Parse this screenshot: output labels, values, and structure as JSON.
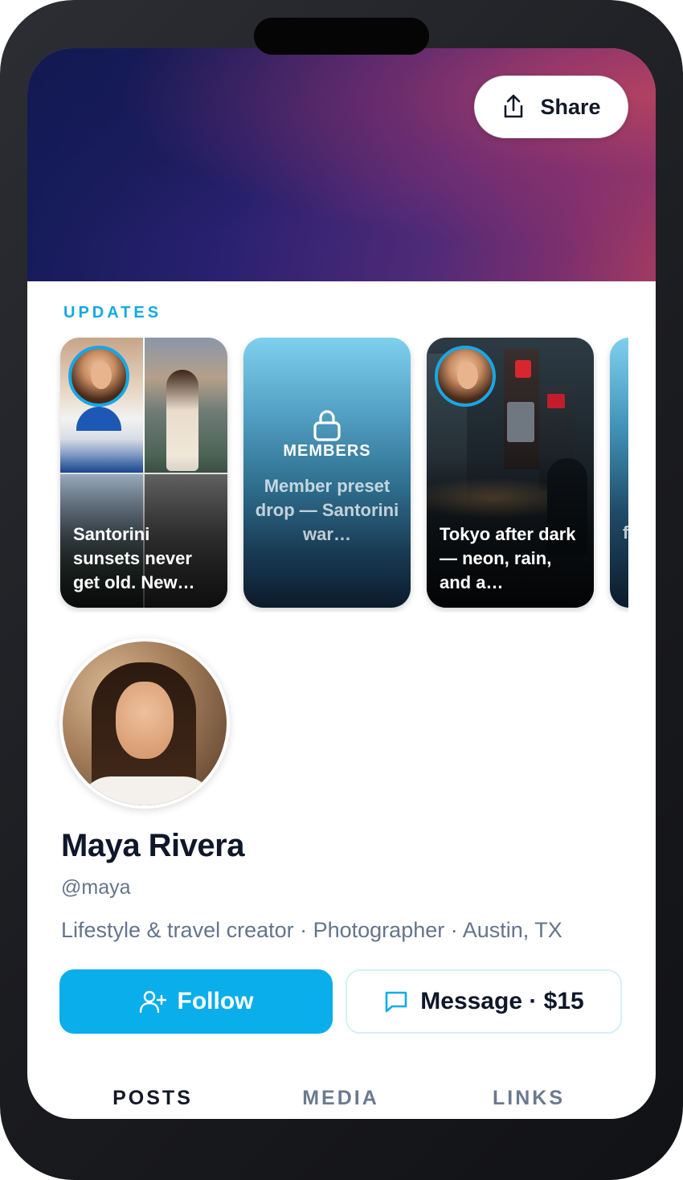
{
  "header": {
    "share_label": "Share",
    "share_icon": "share-upload-icon"
  },
  "updates": {
    "section_label": "UPDATES",
    "stories": [
      {
        "caption": "Santorini sunsets never get old. New…",
        "has_avatar": true
      },
      {
        "badge": "MEMBERS",
        "caption": "Member preset drop — Santorini war…",
        "locked": true,
        "icon": "lock-icon"
      },
      {
        "caption": "Tokyo after dark — neon, rain, and a…",
        "has_avatar": true
      },
      {
        "caption": "f"
      }
    ]
  },
  "profile": {
    "name": "Maya Rivera",
    "handle": "@maya",
    "bio": "Lifestyle & travel creator · Photographer · Austin, TX"
  },
  "actions": {
    "follow_label": "Follow",
    "follow_icon": "add-user-icon",
    "message_label": "Message · $15",
    "message_icon": "chat-bubble-icon"
  },
  "tabs": [
    {
      "label": "POSTS",
      "active": true
    },
    {
      "label": "MEDIA",
      "active": false
    },
    {
      "label": "LINKS",
      "active": false
    }
  ],
  "colors": {
    "accent": "#0aaeea",
    "updates_label": "#14a8e3",
    "text_primary": "#0f172a",
    "text_secondary": "#64748b"
  }
}
